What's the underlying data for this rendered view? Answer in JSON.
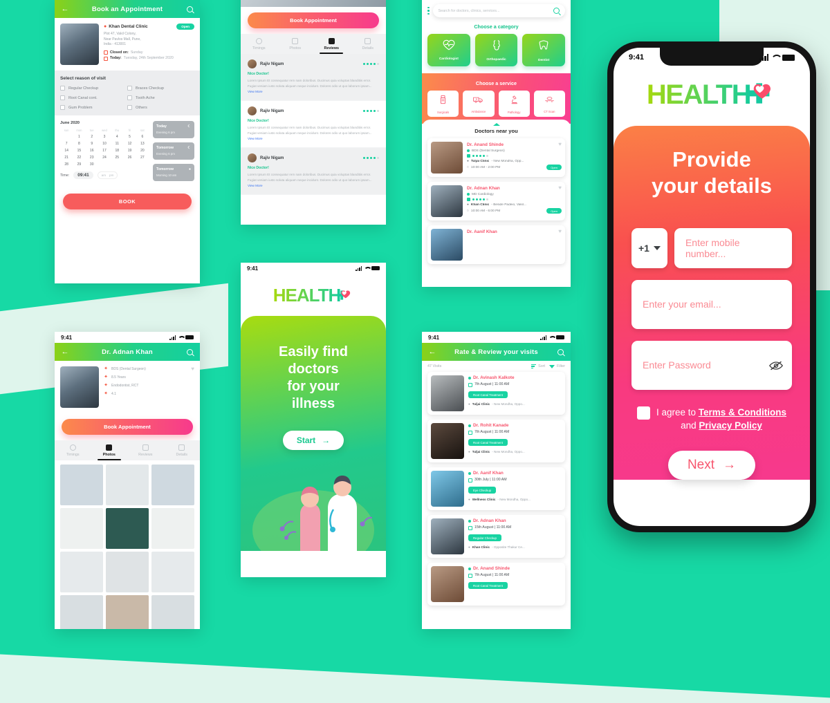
{
  "background": {
    "teal": "#17D9A5",
    "mint": "#DFF5EC"
  },
  "brand": {
    "name_text": "HEALTH",
    "accent_green": "#A6D90E",
    "accent_teal": "#16CC9B",
    "accent_pink": "#F7566E"
  },
  "status_bar": {
    "time": "9:41"
  },
  "screen_book": {
    "appbar_title": "Book an Appointment",
    "back_icon": "arrow-left-icon",
    "search_icon": "search-icon",
    "clinic": {
      "name": "Khan Dental Clinic",
      "badge": "Open",
      "address": "Plot 47, Vakil Colony,\nNear Pavlos Mall, Pune,\nIndia - 413001",
      "closed_label": "Closed on:",
      "closed_value": "Sunday",
      "today_label": "Today:",
      "today_value": "Tuesday, 24th September 2020"
    },
    "reason_title": "Select reason of visit",
    "reasons": [
      "Regular Checkup",
      "Braces Checkup",
      "Root Canal cont.",
      "Tooth Ache",
      "Gum Problem",
      "Others"
    ],
    "calendar": {
      "month": "June 2020",
      "dow": [
        "sun",
        "mon",
        "tue",
        "wed",
        "thu",
        "fri",
        "sat"
      ],
      "leading_blanks": 1,
      "days": [
        1,
        2,
        3,
        4,
        5,
        6,
        7,
        8,
        9,
        10,
        11,
        12,
        13,
        14,
        15,
        16,
        17,
        18,
        19,
        20,
        21,
        22,
        23,
        24,
        25,
        26,
        27,
        28,
        29,
        30
      ]
    },
    "time_label": "Time:",
    "time_value": "09:41",
    "am_label": "am",
    "pm_label": "pm",
    "slots": [
      {
        "title": "Today",
        "sub": "Evening 6 pm",
        "icon": "moon-icon"
      },
      {
        "title": "Tomorrow",
        "sub": "Evening 6 pm",
        "icon": "moon-icon"
      },
      {
        "title": "Tomorrow",
        "sub": "Morning 10 am",
        "icon": "sun-icon"
      }
    ],
    "book_button": "BOOK"
  },
  "screen_reviews": {
    "book_button": "Book Appointment",
    "tabs": [
      {
        "label": "Timings",
        "icon": "clock-icon",
        "active": false
      },
      {
        "label": "Photos",
        "icon": "photo-icon",
        "active": false
      },
      {
        "label": "Reviews",
        "icon": "review-icon",
        "active": true
      },
      {
        "label": "Details",
        "icon": "info-icon",
        "active": false
      }
    ],
    "reviews": [
      {
        "name": "Rajiv Nigam",
        "rating": 4,
        "title": "Nice Doctor!",
        "text": "Lorem Ipsum Et consequatur rem nam doloribus. Ducimus quia voluptas blanditiis error. Fugiat veniam iusto soluta aliquam neque incidunt. Dolores odio ut quo laborum ipsam...",
        "view_more": "View More"
      },
      {
        "name": "Rajiv Nigam",
        "rating": 4,
        "title": "Nice Doctor!",
        "text": "Lorem Ipsum Et consequatur rem nam doloribus. Ducimus quia voluptas blanditiis error. Fugiat veniam iusto soluta aliquam neque incidunt. Dolores odio ut quo laborum ipsam...",
        "view_more": "View More"
      },
      {
        "name": "Rajiv Nigam",
        "rating": 4,
        "title": "Nice Doctor!",
        "text": "Lorem Ipsum Et consequatur rem nam doloribus. Ducimus quia voluptas blanditiis error. Fugiat veniam iusto soluta aliquam neque incidunt. Dolores odio ut quo laborum ipsam...",
        "view_more": "View More"
      }
    ]
  },
  "screen_home": {
    "search_placeholder": "Search for doctors, clinics, services...",
    "menu_icon": "kebab-menu-icon",
    "search_icon": "search-icon",
    "category_title": "Choose a category",
    "categories": [
      {
        "label": "Cardiologist",
        "icon": "heart-pulse-icon"
      },
      {
        "label": "Orthopaedic",
        "icon": "bone-joint-icon"
      },
      {
        "label": "Dentist",
        "icon": "tooth-icon"
      }
    ],
    "service_title": "Choose a service",
    "services": [
      {
        "label": "Surgicals",
        "icon": "surgicals-icon"
      },
      {
        "label": "Ambulance",
        "icon": "ambulance-icon"
      },
      {
        "label": "Pathology",
        "icon": "microscope-icon"
      },
      {
        "label": "CT Scan",
        "icon": "ct-scan-icon"
      }
    ],
    "near_title": "Doctors near you",
    "doctors": [
      {
        "name": "Dr. Anand Shinde",
        "qual": "BDS (Dental Surgeon)",
        "rating": 4,
        "clinic": "Tuljai Clinic",
        "clinic_sub": "- New Mondha, Opp...",
        "hours": "10:00 AM - 2:00 PM",
        "status": "Open"
      },
      {
        "name": "Dr. Adnan Khan",
        "qual": "MD Cardiology",
        "rating": 4,
        "clinic": "Khan Clinic",
        "clinic_sub": "- Beside Padeio, Vakil...",
        "hours": "10:00 AM - 6:00 PM",
        "status": "Open"
      },
      {
        "name": "Dr. Aanif Khan",
        "qual": "",
        "rating": 0,
        "clinic": "",
        "clinic_sub": "",
        "hours": "",
        "status": ""
      }
    ]
  },
  "screen_splash": {
    "headline": "Easily find\ndoctors\nfor your\nillness",
    "start_button": "Start",
    "arrow_icon": "arrow-right-icon"
  },
  "screen_profile": {
    "appbar_title": "Dr. Adnan Khan",
    "details": [
      {
        "icon": "medal-icon",
        "text": "BDS (Dental Surgeon)"
      },
      {
        "icon": "experience-icon",
        "text": "8.5 Years"
      },
      {
        "icon": "speciality-icon",
        "text": "Endodontist, RCT"
      },
      {
        "icon": "star-icon",
        "text": "4.1"
      }
    ],
    "favourite_icon": "heart-icon",
    "book_button": "Book Appointment",
    "tabs": [
      {
        "label": "Timings",
        "icon": "clock-icon",
        "active": false
      },
      {
        "label": "Photos",
        "icon": "photo-icon",
        "active": true
      },
      {
        "label": "Reviews",
        "icon": "review-icon",
        "active": false
      },
      {
        "label": "Details",
        "icon": "info-icon",
        "active": false
      }
    ],
    "photo_count": 12
  },
  "screen_visits": {
    "appbar_title": "Rate & Review your visits",
    "count_label": "47 Visits",
    "sort_label": "Sort",
    "filter_label": "Filter",
    "visits": [
      {
        "name": "Dr. Avinash Kalkote",
        "datetime": "7th August | 11:00 AM",
        "tag": "Root Canal Treatment",
        "clinic": "Tuljai Clinic",
        "clinic_sub": "- New Mondha, Oppo..."
      },
      {
        "name": "Dr. Rohit Kanade",
        "datetime": "7th August | 11:00 AM",
        "tag": "Root Canal Treatment",
        "clinic": "Tuljai Clinic",
        "clinic_sub": "- New Mondha, Oppo..."
      },
      {
        "name": "Dr. Aanif Khan",
        "datetime": "30th July | 11:00 AM",
        "tag": "Eye Checkup",
        "clinic": "Wellness Clinic",
        "clinic_sub": "- New Mondha, Oppo..."
      },
      {
        "name": "Dr. Adnan Khan",
        "datetime": "15th August | 11:00 AM",
        "tag": "Regular Checkup",
        "clinic": "Khan Clinic",
        "clinic_sub": "- Opposite Thakur Ce..."
      },
      {
        "name": "Dr. Anand Shinde",
        "datetime": "7th August | 11:00 AM",
        "tag": "Root Canal Treatment",
        "clinic": "",
        "clinic_sub": ""
      }
    ]
  },
  "screen_signup": {
    "headline": "Provide\nyour details",
    "country_code": "+1",
    "mobile_placeholder": "Enter mobile number...",
    "email_placeholder": "Enter your email...",
    "password_placeholder": "Enter Password",
    "eye_icon": "eye-off-icon",
    "agree_prefix": "I agree to ",
    "terms_link": "Terms & Conditions",
    "agree_and": "and ",
    "privacy_link": "Privacy Policy",
    "next_button": "Next",
    "arrow_icon": "arrow-right-icon"
  }
}
